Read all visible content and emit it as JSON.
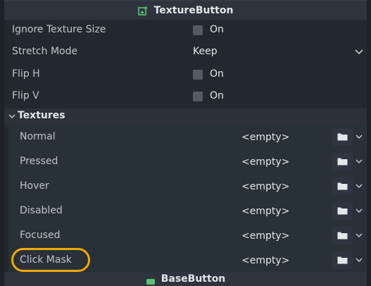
{
  "header": {
    "title": "TextureButton",
    "icon": "texture-button-icon"
  },
  "properties": [
    {
      "label": "Ignore Texture Size",
      "type": "checkbox",
      "checked": false,
      "value": "On"
    },
    {
      "label": "Stretch Mode",
      "type": "dropdown",
      "value": "Keep"
    },
    {
      "label": "Flip H",
      "type": "checkbox",
      "checked": false,
      "value": "On"
    },
    {
      "label": "Flip V",
      "type": "checkbox",
      "checked": false,
      "value": "On"
    }
  ],
  "textures": {
    "label": "Textures",
    "items": [
      {
        "label": "Normal",
        "value": "<empty>"
      },
      {
        "label": "Pressed",
        "value": "<empty>"
      },
      {
        "label": "Hover",
        "value": "<empty>"
      },
      {
        "label": "Disabled",
        "value": "<empty>"
      },
      {
        "label": "Focused",
        "value": "<empty>"
      },
      {
        "label": "Click Mask",
        "value": "<empty>"
      }
    ]
  },
  "footer": {
    "title": "BaseButton",
    "icon": "base-button-icon"
  },
  "colors": {
    "accent": "#4caf6a",
    "highlight": "#f5a800"
  }
}
